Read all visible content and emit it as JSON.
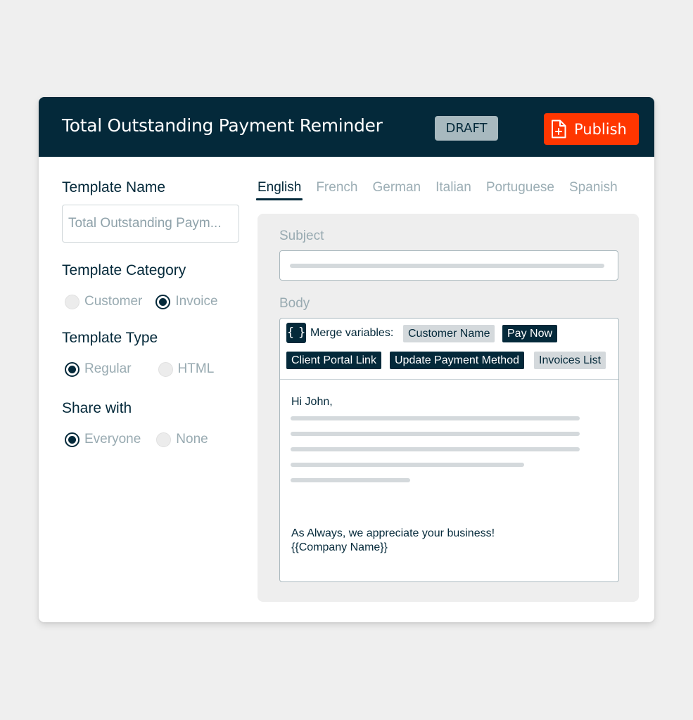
{
  "header": {
    "title": "Total Outstanding Payment Reminder",
    "status_badge": "DRAFT",
    "publish_label": "Publish",
    "publish_icon": "file-plus-icon",
    "colors": {
      "header_bg": "#04293a",
      "publish_bg": "#ff3600",
      "badge_bg": "#a8b9bf"
    }
  },
  "form": {
    "template_name": {
      "label": "Template Name",
      "value": "Total Outstanding Paym..."
    },
    "template_category": {
      "label": "Template Category",
      "options": [
        {
          "label": "Customer",
          "selected": false
        },
        {
          "label": "Invoice",
          "selected": true
        }
      ]
    },
    "template_type": {
      "label": "Template Type",
      "options": [
        {
          "label": "Regular",
          "selected": true
        },
        {
          "label": "HTML",
          "selected": false
        }
      ]
    },
    "share_with": {
      "label": "Share with",
      "options": [
        {
          "label": "Everyone",
          "selected": true
        },
        {
          "label": "None",
          "selected": false
        }
      ]
    }
  },
  "language_tabs": [
    {
      "label": "English",
      "active": true
    },
    {
      "label": "French",
      "active": false
    },
    {
      "label": "German",
      "active": false
    },
    {
      "label": "Italian",
      "active": false
    },
    {
      "label": "Portuguese",
      "active": false
    },
    {
      "label": "Spanish",
      "active": false
    }
  ],
  "editor": {
    "subject_label": "Subject",
    "body_label": "Body",
    "merge_icon": "braces-icon",
    "merge_icon_glyph": "{ }",
    "merge_label": "Merge variables:",
    "merge_variables": [
      {
        "label": "Customer Name",
        "style": "light"
      },
      {
        "label": "Pay Now",
        "style": "dark"
      },
      {
        "label": "Client Portal Link",
        "style": "dark"
      },
      {
        "label": "Update Payment Method",
        "style": "dark"
      },
      {
        "label": "Invoices List",
        "style": "light"
      }
    ],
    "greeting": "Hi John,",
    "closing": "As Always, we appreciate your business!",
    "signature": "{{Company Name}}"
  }
}
